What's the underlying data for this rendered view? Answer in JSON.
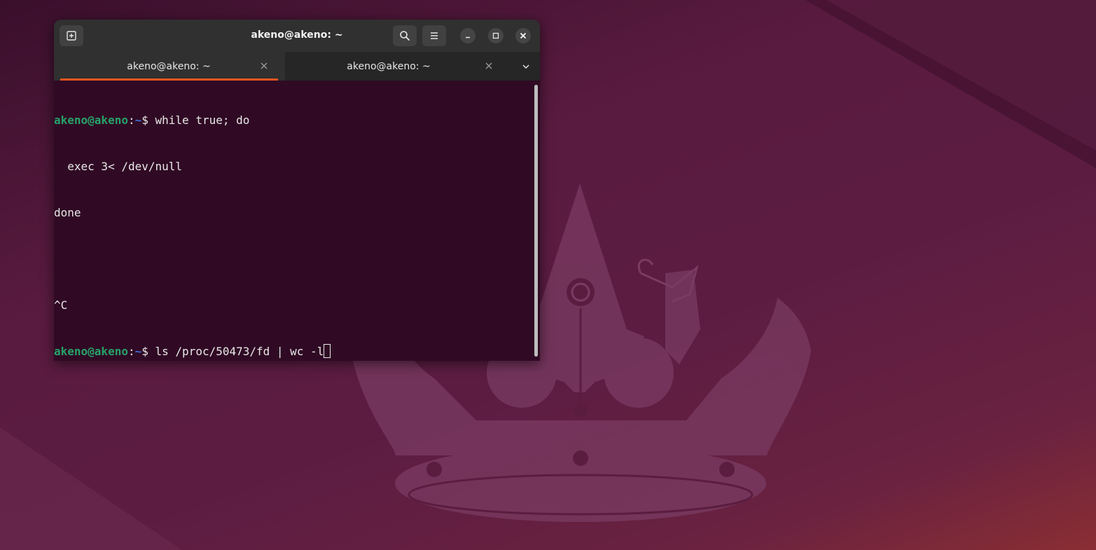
{
  "window": {
    "title": "akeno@akeno: ~"
  },
  "tabs": [
    {
      "label": "akeno@akeno: ~",
      "active": true
    },
    {
      "label": "akeno@akeno: ~",
      "active": false
    }
  ],
  "icons": {
    "new_tab": "new-tab-icon",
    "search": "search-icon",
    "menu": "hamburger-menu-icon",
    "minimize": "minimize-icon",
    "maximize": "maximize-icon",
    "close": "close-icon",
    "tab_close": "close-icon",
    "tab_overflow": "chevron-down-icon"
  },
  "terminal": {
    "prompt": {
      "user_host": "akeno@akeno",
      "colon": ":",
      "path": "~",
      "symbol": "$ "
    },
    "lines": [
      {
        "type": "prompt",
        "command": "while true; do"
      },
      {
        "type": "output",
        "text": "  exec 3< /dev/null"
      },
      {
        "type": "output",
        "text": "done"
      },
      {
        "type": "output",
        "text": ""
      },
      {
        "type": "output",
        "text": "^C"
      },
      {
        "type": "prompt",
        "command": "ls /proc/50473/fd | wc -l"
      }
    ]
  },
  "colors": {
    "accent": "#e95420",
    "terminal_bg": "#300a24",
    "prompt_user": "#26a269",
    "prompt_path": "#3f6fd8"
  }
}
